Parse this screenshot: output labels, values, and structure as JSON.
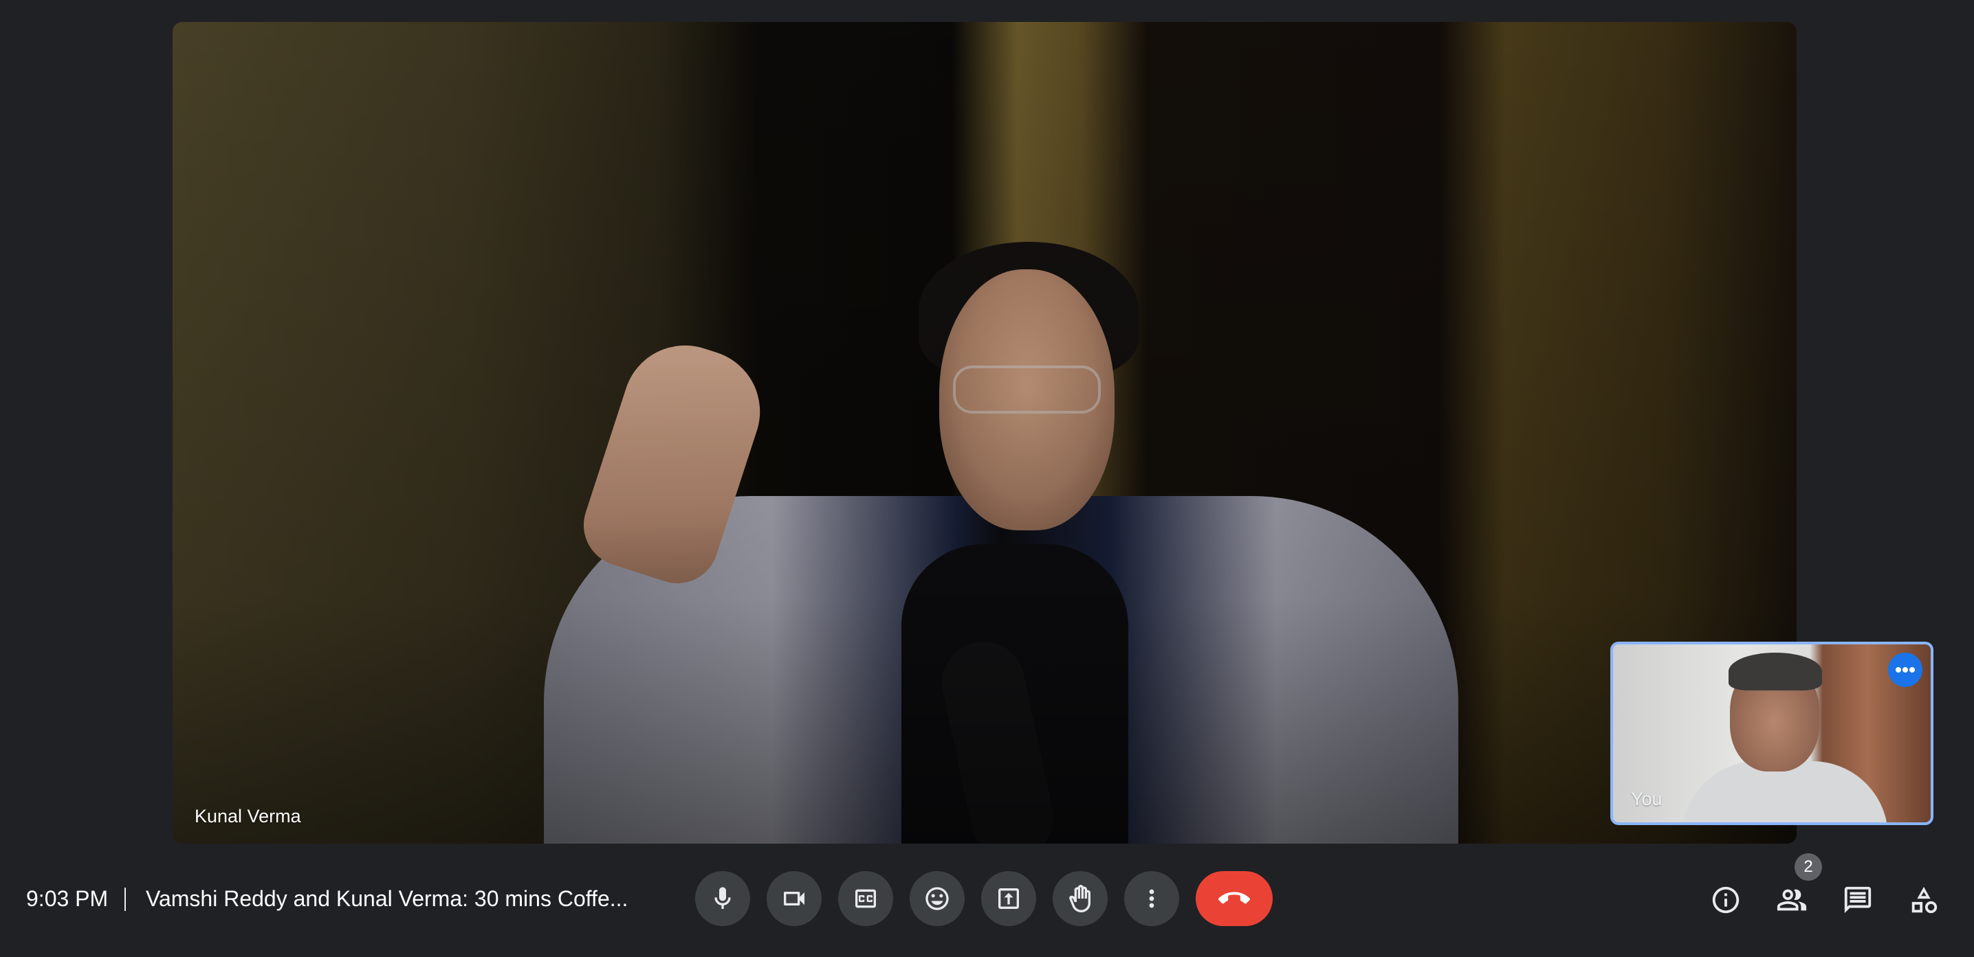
{
  "main_video": {
    "participant_name": "Kunal Verma"
  },
  "self_view": {
    "label": "You"
  },
  "bottom_bar": {
    "time": "9:03 PM",
    "meeting_title": "Vamshi Reddy and Kunal Verma: 30 mins Coffe...",
    "controls": [
      {
        "name": "microphone-icon"
      },
      {
        "name": "camera-icon"
      },
      {
        "name": "captions-icon"
      },
      {
        "name": "emoji-icon"
      },
      {
        "name": "present-screen-icon"
      },
      {
        "name": "raise-hand-icon"
      },
      {
        "name": "more-options-icon"
      },
      {
        "name": "end-call-icon"
      }
    ],
    "right_controls": [
      {
        "name": "info-icon"
      },
      {
        "name": "people-icon"
      },
      {
        "name": "chat-icon"
      },
      {
        "name": "activities-icon"
      }
    ],
    "people_count": "2"
  },
  "colors": {
    "background": "#202124",
    "control_bg": "#3c4043",
    "end_call": "#ea4335",
    "self_view_border": "#8ab4f8",
    "accent_blue": "#1a73e8"
  }
}
